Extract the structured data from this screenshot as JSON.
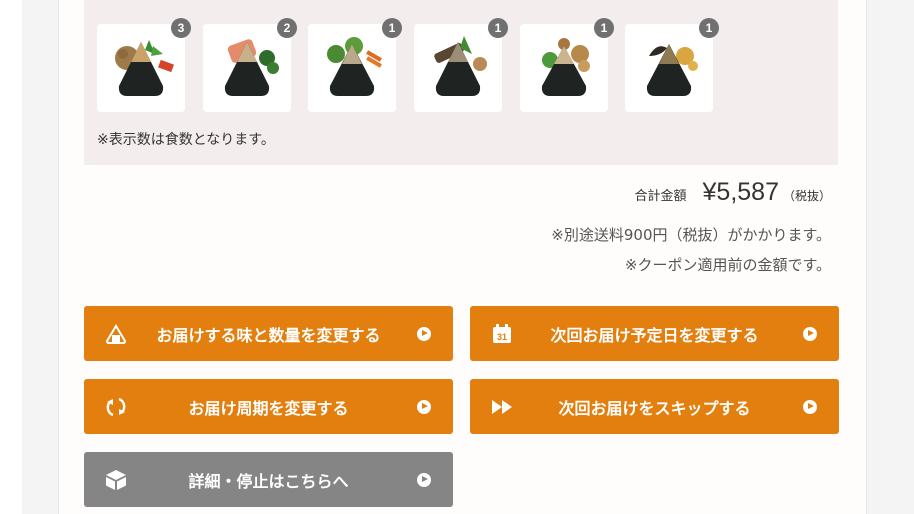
{
  "items": {
    "thumbnails": [
      {
        "name": "onigiri-meal-1",
        "qty": "3"
      },
      {
        "name": "onigiri-meal-2",
        "qty": "2"
      },
      {
        "name": "onigiri-meal-3",
        "qty": "1"
      },
      {
        "name": "onigiri-meal-4",
        "qty": "1"
      },
      {
        "name": "onigiri-meal-5",
        "qty": "1"
      },
      {
        "name": "onigiri-meal-6",
        "qty": "1"
      }
    ],
    "note": "※表示数は食数となります。"
  },
  "summary": {
    "total_label": "合計金額",
    "total_value": "¥5,587",
    "total_suffix": "（税抜）",
    "shipping_note": "※別途送料900円（税抜）がかかります。",
    "coupon_note": "※クーポン適用前の金額です。"
  },
  "actions": {
    "change_flavor": {
      "label": "お届けする味と数量を変更する",
      "icon": "onigiri-icon"
    },
    "change_date": {
      "label": "次回お届け予定日を変更する",
      "icon": "calendar-icon",
      "calendar_number": "31"
    },
    "change_cycle": {
      "label": "お届け周期を変更する",
      "icon": "refresh-icon"
    },
    "skip_next": {
      "label": "次回お届けをスキップする",
      "icon": "fast-forward-icon"
    },
    "details_stop": {
      "label": "詳細・停止はこちらへ",
      "icon": "package-icon"
    }
  },
  "colors": {
    "accent": "#e37f0e",
    "secondary_button": "#858585",
    "items_background": "#f4eded",
    "badge": "#707070"
  }
}
